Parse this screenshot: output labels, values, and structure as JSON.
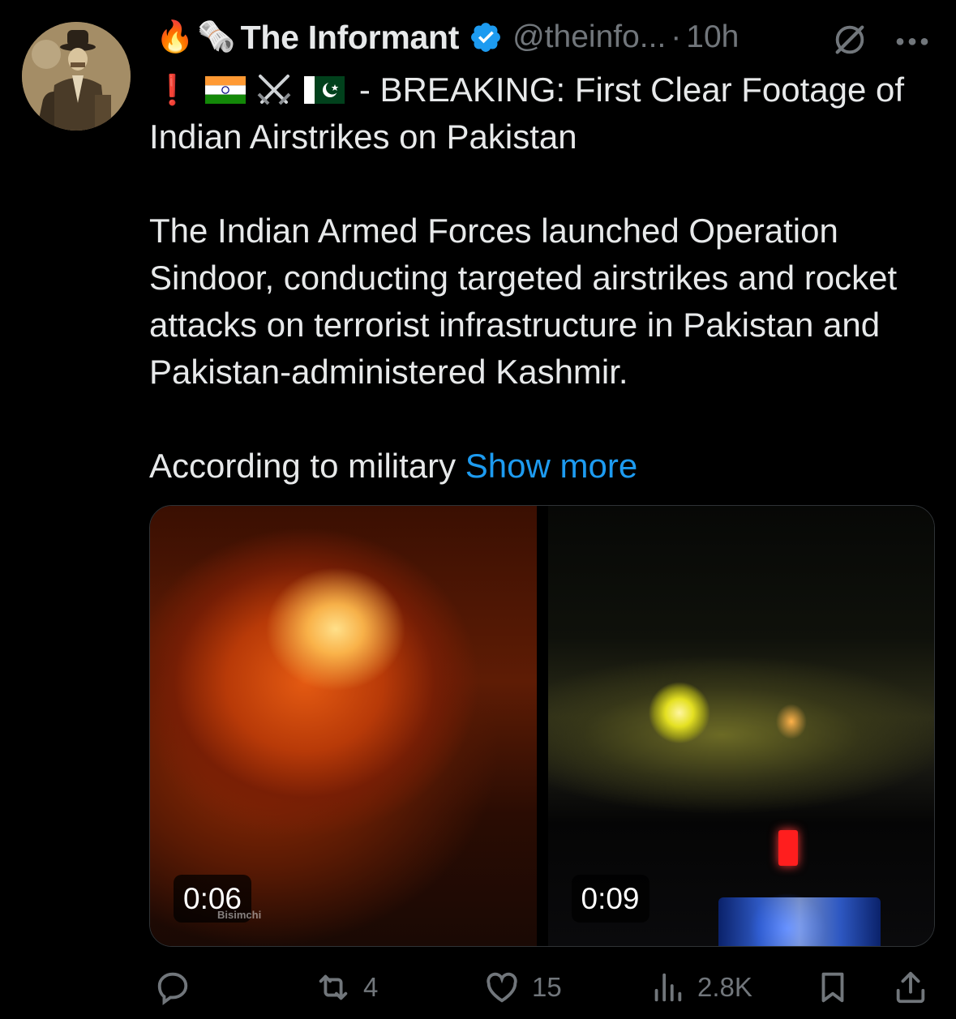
{
  "tweet": {
    "author": {
      "display_name": "The Informant",
      "handle": "@theinfo...",
      "verified": true,
      "name_emojis": [
        "🔥",
        "🗞️"
      ]
    },
    "separator": "·",
    "time": "10h",
    "line1_emojis": [
      "❗",
      "🇮🇳",
      "⚔️",
      "🇵🇰"
    ],
    "headline": "- BREAKING: First Clear Footage of",
    "headline_cont": "Indian Airstrikes on Pakistan",
    "paragraph1": "The Indian Armed Forces launched Operation Sindoor, conducting targeted airstrikes and rocket attacks on terrorist infrastructure in Pakistan and Pakistan-administered Kashmir.",
    "paragraph2_start": "According to military",
    "show_more": "Show more"
  },
  "media": [
    {
      "type": "video",
      "duration": "0:06",
      "watermark": "Bisimchi"
    },
    {
      "type": "video",
      "duration": "0:09"
    }
  ],
  "actions": {
    "reply_count": "",
    "retweet_count": "4",
    "like_count": "15",
    "views_count": "2.8K"
  },
  "colors": {
    "background": "#000000",
    "text": "#e7e9ea",
    "secondary": "#71767b",
    "link": "#1d9bf0",
    "verified": "#1d9bf0"
  },
  "icons": [
    "grok-icon",
    "more-options-icon",
    "reply-icon",
    "retweet-icon",
    "like-icon",
    "views-icon",
    "bookmark-icon",
    "share-icon"
  ]
}
